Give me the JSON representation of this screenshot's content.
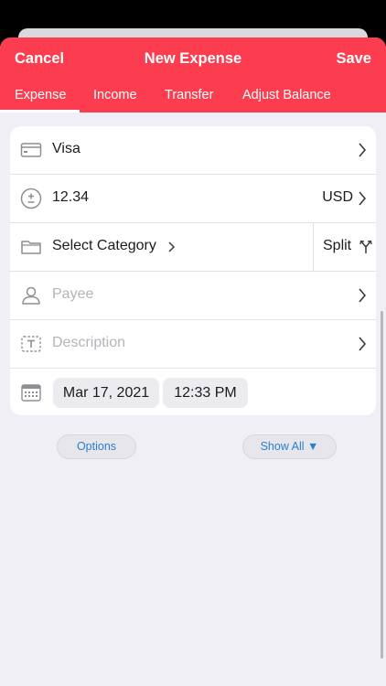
{
  "header": {
    "cancel_label": "Cancel",
    "title": "New Expense",
    "save_label": "Save",
    "accent_color": "#fc3d50"
  },
  "tabs": [
    {
      "label": "Expense",
      "active": true
    },
    {
      "label": "Income"
    },
    {
      "label": "Transfer"
    },
    {
      "label": "Adjust Balance"
    }
  ],
  "form": {
    "account": "Visa",
    "amount": "12.34",
    "currency": "USD",
    "category": "Select Category",
    "split_label": "Split",
    "payee_placeholder": "Payee",
    "description_placeholder": "Description",
    "date": "Mar 17, 2021",
    "time": "12:33 PM"
  },
  "footer": {
    "options_label": "Options",
    "show_all_label": "Show All ▼"
  }
}
